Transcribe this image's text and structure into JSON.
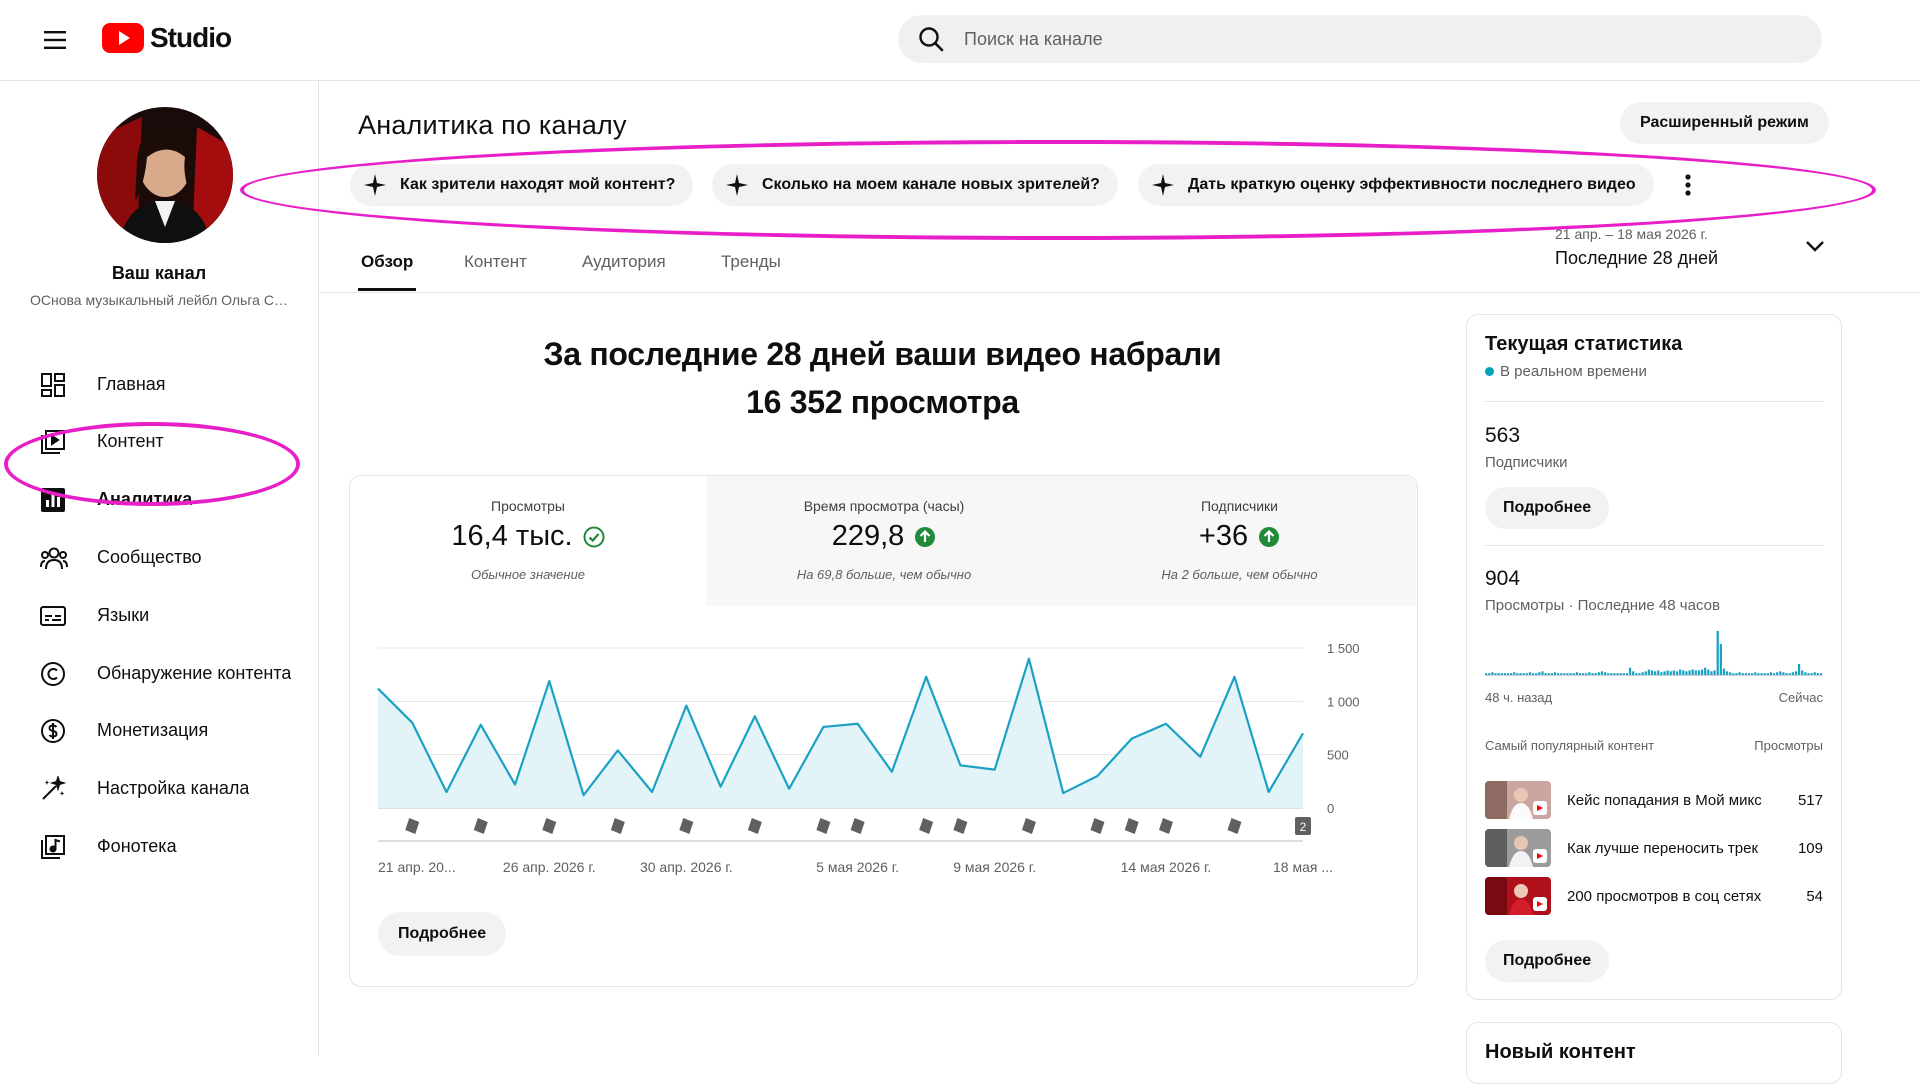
{
  "app": {
    "logo_text": "Studio"
  },
  "search": {
    "placeholder": "Поиск на канале"
  },
  "sidebar": {
    "channel_name": "Ваш канал",
    "channel_subtitle": "ОСнова музыкальный лейбл Ольга Семенова",
    "items": [
      {
        "label": "Главная",
        "icon": "dashboard-icon"
      },
      {
        "label": "Контент",
        "icon": "content-icon"
      },
      {
        "label": "Аналитика",
        "icon": "analytics-icon",
        "active": true
      },
      {
        "label": "Сообщество",
        "icon": "community-icon"
      },
      {
        "label": "Языки",
        "icon": "subtitles-icon"
      },
      {
        "label": "Обнаружение контента",
        "icon": "copyright-icon"
      },
      {
        "label": "Монетизация",
        "icon": "monetization-icon"
      },
      {
        "label": "Настройка канала",
        "icon": "customization-icon"
      },
      {
        "label": "Фонотека",
        "icon": "audio-library-icon"
      }
    ]
  },
  "main": {
    "title": "Аналитика по каналу",
    "advanced_mode": "Расширенный режим",
    "ask_chips": [
      "Как зрители находят мой контент?",
      "Сколько на моем канале новых зрителей?",
      "Дать краткую оценку эффективности последнего видео"
    ],
    "tabs": [
      "Обзор",
      "Контент",
      "Аудитория",
      "Тренды"
    ],
    "date_range": {
      "range": "21 апр. – 18 мая 2026 г.",
      "label": "Последние 28 дней"
    },
    "headline_line1": "За последние 28 дней ваши видео набрали",
    "headline_line2": "16 352 просмотра",
    "metrics": [
      {
        "label": "Просмотры",
        "value": "16,4 тыс.",
        "note": "Обычное значение",
        "status": "normal"
      },
      {
        "label": "Время просмотра (часы)",
        "value": "229,8",
        "note": "На 69,8 больше, чем обычно",
        "status": "up"
      },
      {
        "label": "Подписчики",
        "value": "+36",
        "note": "На 2 больше, чем обычно",
        "status": "up"
      }
    ],
    "details_button": "Подробнее",
    "colors": {
      "accent": "#1aa1c3",
      "area": "#e3f4f9",
      "up": "#1f8a3a"
    }
  },
  "chart_data": {
    "type": "area",
    "y_ticks": [
      "1 500",
      "1 000",
      "500",
      "0"
    ],
    "ylim": [
      0,
      1500
    ],
    "x_tick_labels": [
      "21 апр. 20...",
      "26 апр. 2026 г.",
      "30 апр. 2026 г.",
      "5 мая 2026 г.",
      "9 мая 2026 г.",
      "14 мая 2026 г.",
      "18 мая ..."
    ],
    "x_tick_days": [
      0,
      5,
      9,
      14,
      18,
      23,
      27
    ],
    "series": [
      {
        "values": [
          1120,
          800,
          150,
          780,
          220,
          1190,
          120,
          540,
          150,
          960,
          200,
          860,
          180,
          760,
          790,
          340,
          1230,
          400,
          360,
          1400,
          140,
          300,
          650,
          790,
          480,
          1230,
          150,
          700
        ]
      }
    ],
    "upload_markers_days": [
      1,
      3,
      5,
      7,
      9,
      11,
      13,
      14,
      16,
      17,
      19,
      21,
      22,
      23,
      25
    ],
    "badge_count": "2",
    "grid": true
  },
  "realtime": {
    "title": "Текущая статистика",
    "live_label": "В реальном времени",
    "subscribers_value": "563",
    "subscribers_label": "Подписчики",
    "details_button": "Подробнее",
    "views_value": "904",
    "views_label": "Просмотры · Последние 48 часов",
    "spark_values": [
      2,
      2,
      3,
      2,
      2,
      2,
      2,
      2,
      2,
      3,
      2,
      2,
      2,
      2,
      3,
      2,
      2,
      3,
      4,
      2,
      2,
      2,
      3,
      2,
      2,
      2,
      2,
      2,
      2,
      3,
      2,
      2,
      2,
      3,
      2,
      2,
      3,
      4,
      3,
      2,
      2,
      2,
      2,
      2,
      2,
      2,
      8,
      4,
      2,
      2,
      3,
      4,
      6,
      5,
      4,
      5,
      3,
      4,
      5,
      4,
      5,
      4,
      6,
      5,
      4,
      5,
      6,
      5,
      5,
      6,
      8,
      6,
      4,
      5,
      48,
      34,
      7,
      4,
      3,
      2,
      2,
      3,
      2,
      2,
      2,
      2,
      3,
      2,
      2,
      2,
      2,
      3,
      2,
      3,
      4,
      3,
      2,
      2,
      3,
      4,
      12,
      5,
      3,
      2,
      2,
      3,
      2,
      2
    ],
    "ago_label": "48 ч. назад",
    "now_label": "Сейчас",
    "top_content_label": "Самый популярный контент",
    "top_views_label": "Просмотры",
    "top_items": [
      {
        "title": "Кейс попадания в Мой микс",
        "views": "517"
      },
      {
        "title": "Как лучше переносить трек",
        "views": "109"
      },
      {
        "title": "200 просмотров в соц сетях",
        "views": "54"
      }
    ],
    "details_button_2": "Подробнее"
  },
  "new_content": {
    "title": "Новый контент"
  }
}
